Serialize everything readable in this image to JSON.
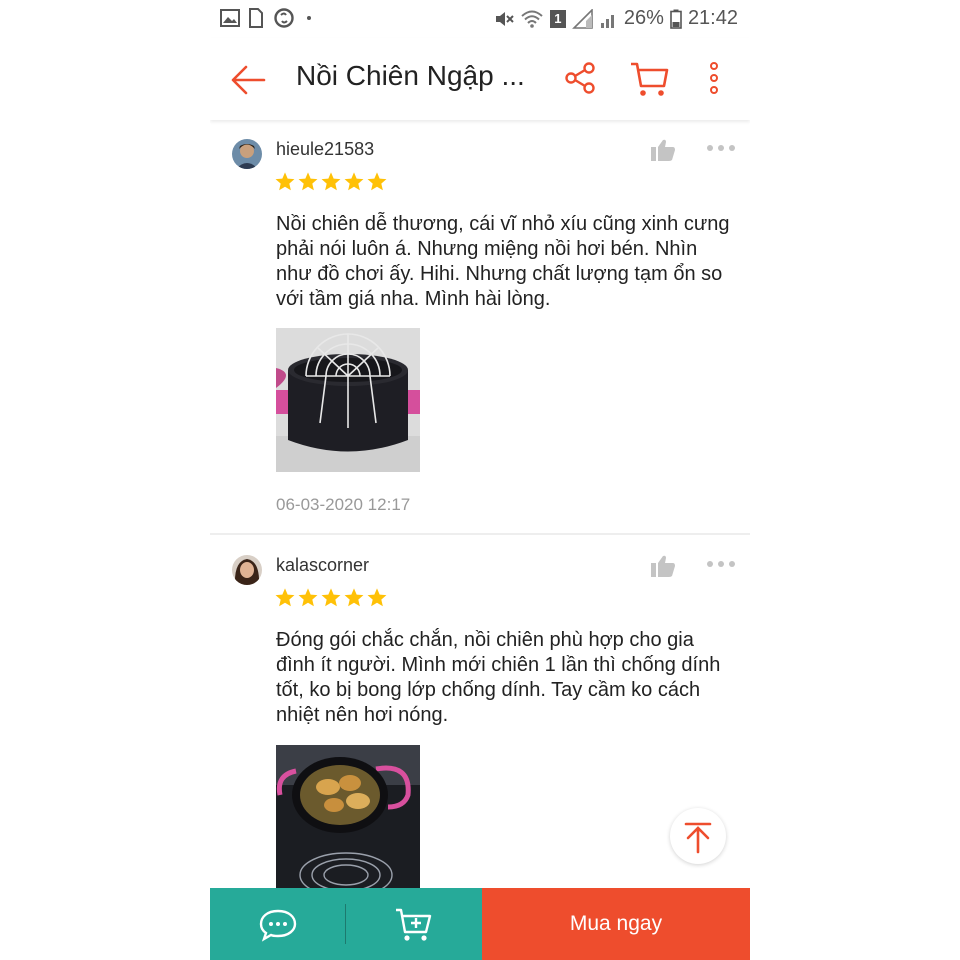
{
  "status_bar": {
    "battery_percent": "26%",
    "time": "21:42",
    "sim_slot": "1",
    "icons": [
      "image-icon",
      "file-icon",
      "shazam-icon",
      "dot-icon",
      "mute-icon",
      "wifi-icon",
      "signal-icon",
      "battery-icon"
    ]
  },
  "header": {
    "title": "Nồi Chiên Ngập ...",
    "accent_color": "#ee4d2d",
    "icons": [
      "back-arrow-icon",
      "share-icon",
      "cart-icon",
      "more-vertical-icon"
    ]
  },
  "reviews": [
    {
      "username": "hieule21583",
      "rating": 5,
      "text": "Nồi chiên dễ thương, cái vĩ nhỏ xíu cũng xinh cưng phải nói luôn á. Nhưng miệng nồi hơi bén. Nhìn như đồ chơi ấy. Hihi. Nhưng chất lượng tạm ổn so với tầm giá nha. Mình hài lòng.",
      "date": "06-03-2020 12:17"
    },
    {
      "username": "kalascorner",
      "rating": 5,
      "text": "Đóng gói chắc chắn, nồi chiên phù hợp cho gia đình ít người. Mình mới chiên 1 lần thì chống dính tốt, ko bị bong lớp chống dính. Tay cầm ko cách nhiệt nên hơi nóng."
    }
  ],
  "bottom_bar": {
    "buy_now_label": "Mua ngay",
    "chat_color": "#26aa99",
    "buy_color": "#ee4d2d"
  },
  "star_color": "#ffc107"
}
